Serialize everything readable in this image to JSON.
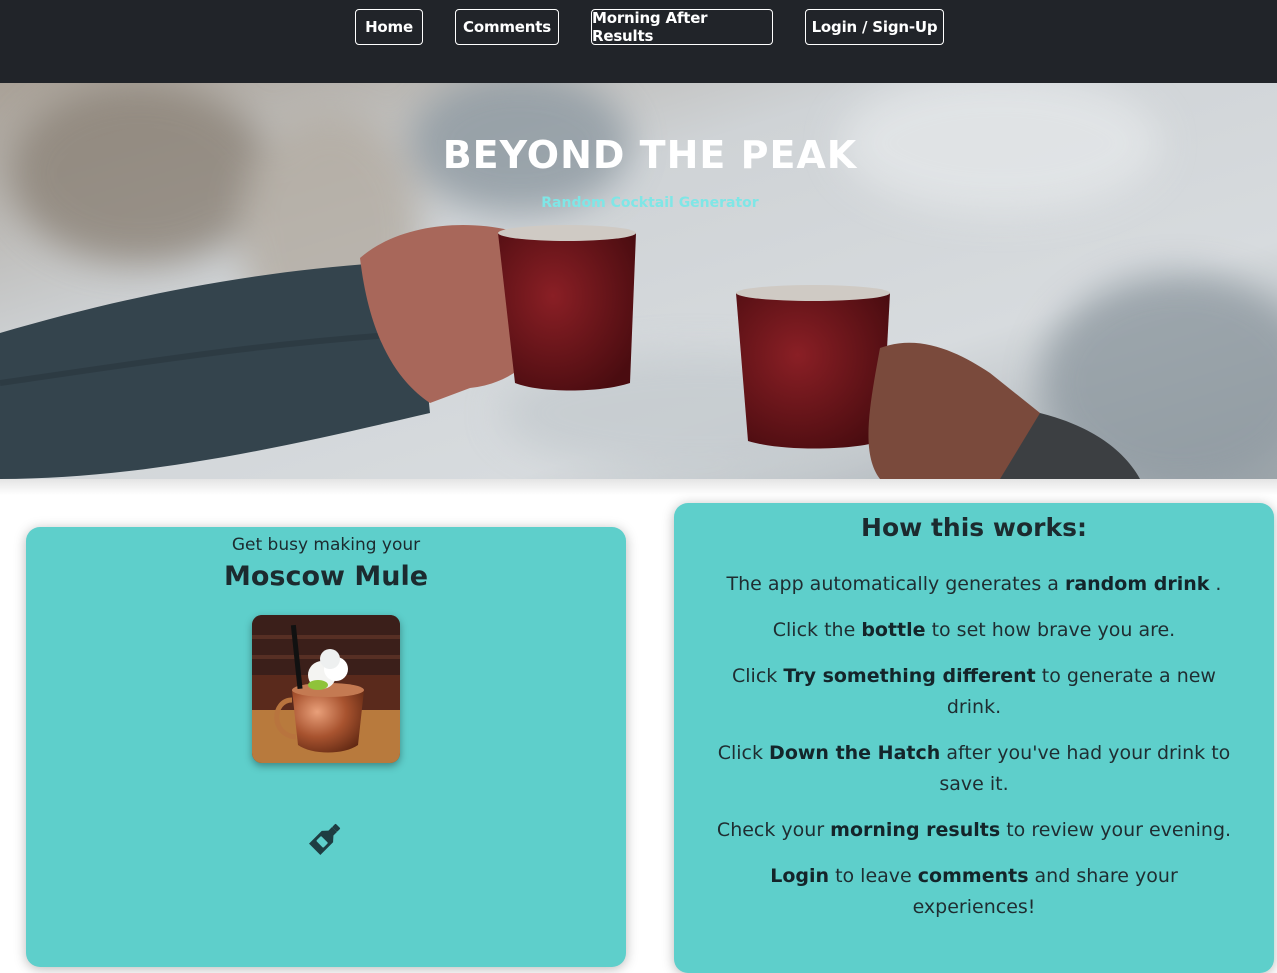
{
  "nav": {
    "items": [
      {
        "label": "Home"
      },
      {
        "label": "Comments"
      },
      {
        "label": "Morning After Results"
      },
      {
        "label": "Login / Sign-Up"
      }
    ]
  },
  "hero": {
    "title": "BEYOND THE PEAK",
    "subtitle": "Random Cocktail Generator"
  },
  "drink_card": {
    "lead": "Get busy making your",
    "drink_name": "Moscow Mule",
    "photo_icon": "moscow-mule-photo",
    "bottle_icon": "bottle-icon"
  },
  "how": {
    "title": "How this works:",
    "steps": [
      {
        "pre": "The app automatically generates a ",
        "bold": "random drink",
        "post": " ."
      },
      {
        "pre": "Click the ",
        "bold": "bottle",
        "post": " to set how brave you are."
      },
      {
        "pre": "Click ",
        "bold": "Try something different",
        "post": " to generate a new drink."
      },
      {
        "pre": "Click ",
        "bold": "Down the Hatch",
        "post": " after you've had your drink to save it."
      },
      {
        "pre": "Check your ",
        "bold": "morning results",
        "post": " to review your evening."
      },
      {
        "pre": "",
        "bold": "Login",
        "mid": " to leave ",
        "bold2": "comments",
        "post": " and share your experiences!"
      }
    ]
  },
  "colors": {
    "nav_bg": "#212429",
    "card_bg": "#5ecfcb",
    "subtitle": "#7fe6e6"
  }
}
